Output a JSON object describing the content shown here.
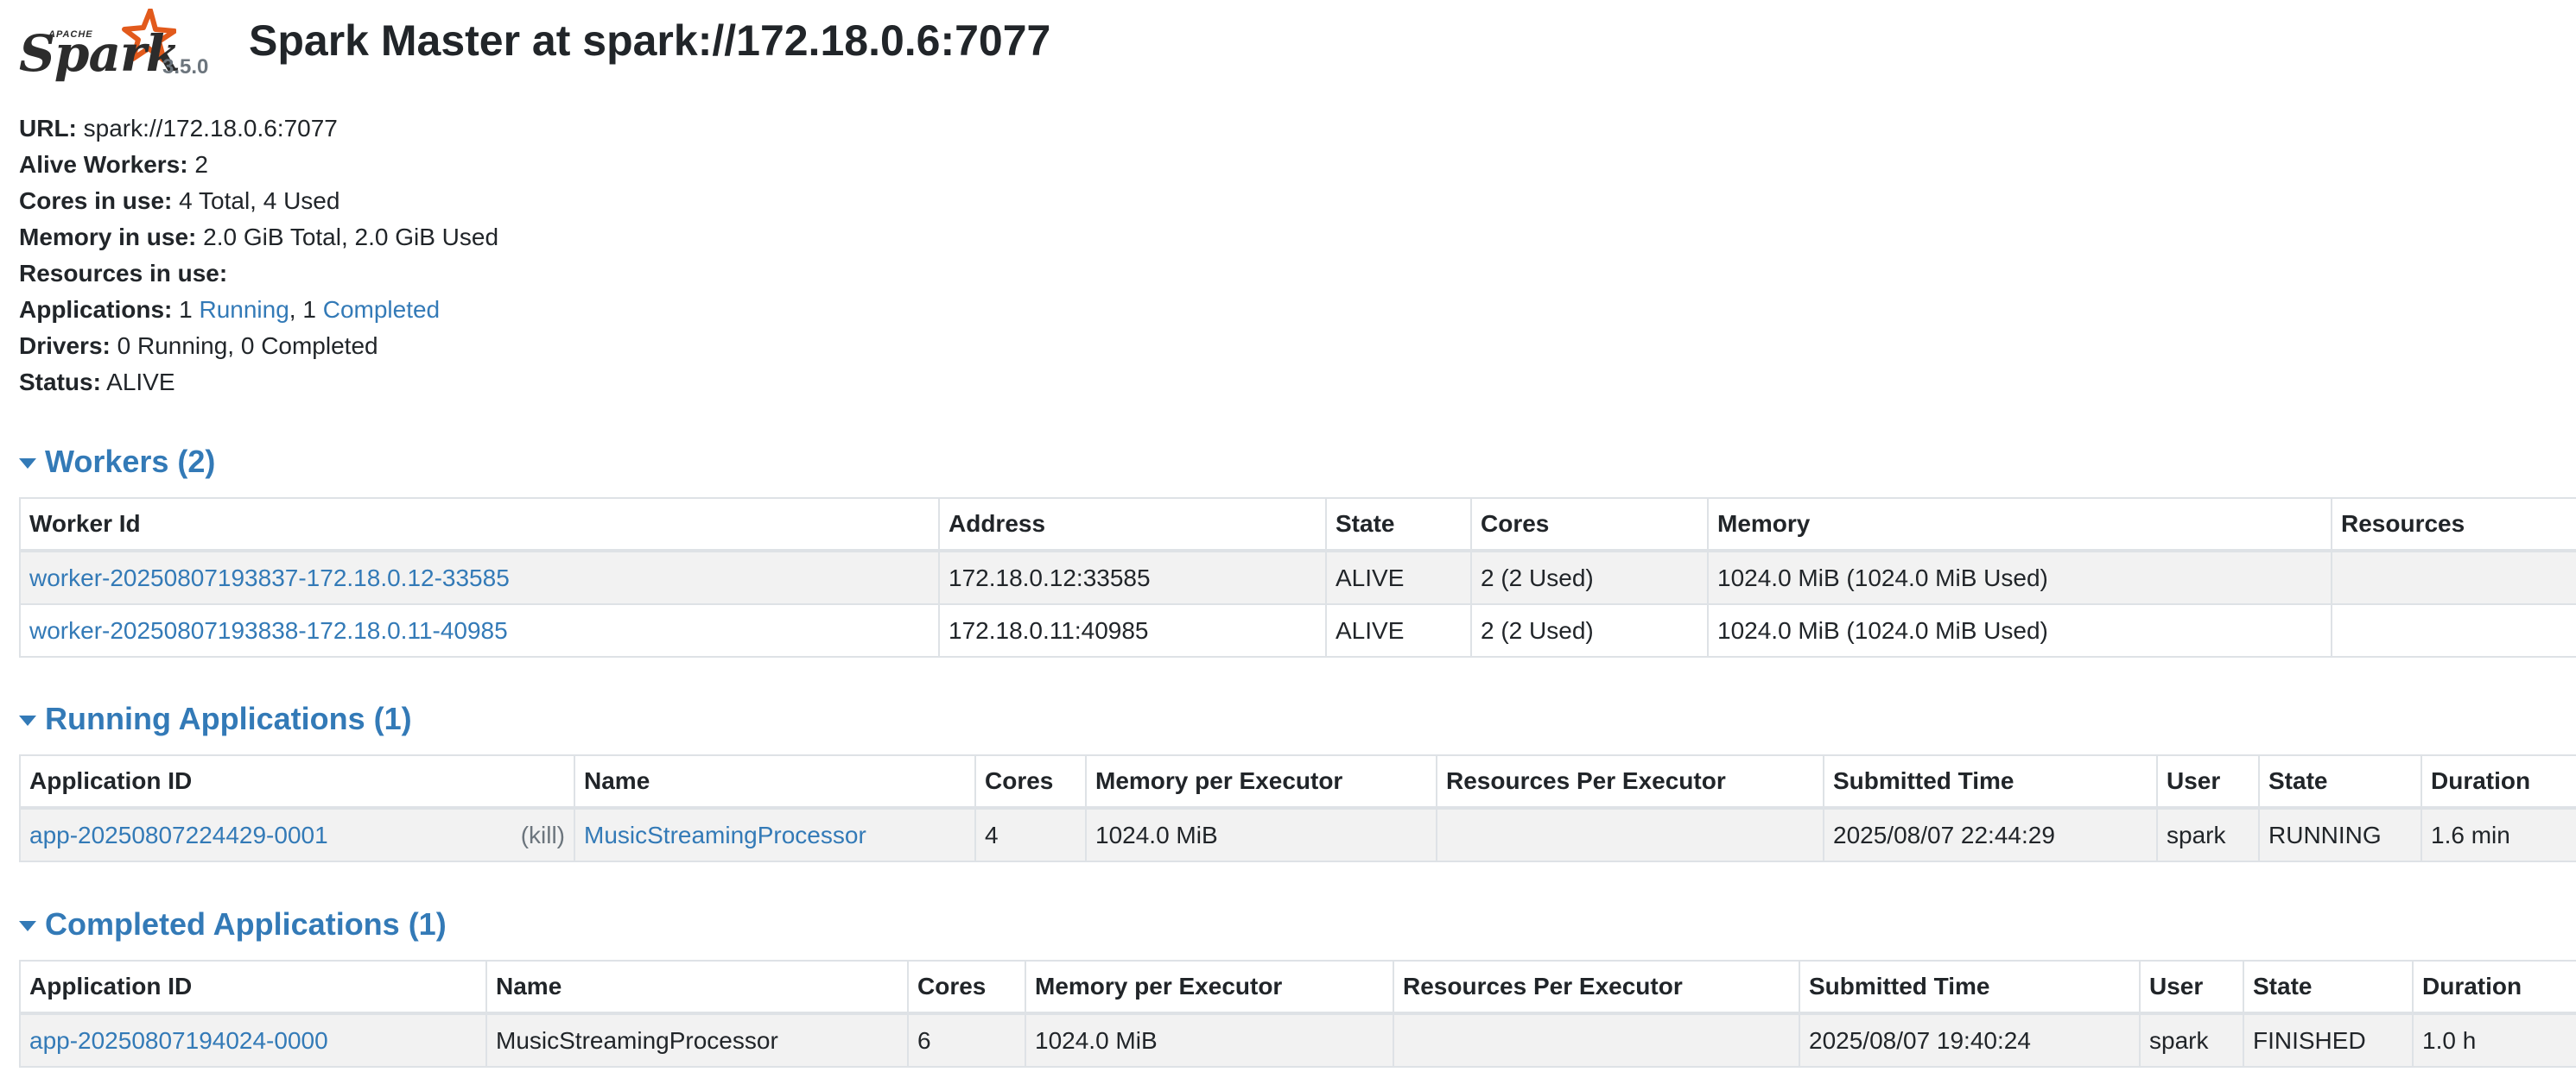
{
  "header": {
    "logo_apache": "APACHE",
    "logo_word": "Spark",
    "version": "3.5.0",
    "title": "Spark Master at spark://172.18.0.6:7077"
  },
  "summary": {
    "url_label": "URL:",
    "url_value": "spark://172.18.0.6:7077",
    "alive_workers_label": "Alive Workers:",
    "alive_workers_value": "2",
    "cores_label": "Cores in use:",
    "cores_value": "4 Total, 4 Used",
    "memory_label": "Memory in use:",
    "memory_value": "2.0 GiB Total, 2.0 GiB Used",
    "resources_label": "Resources in use:",
    "applications_label": "Applications:",
    "applications_running_count": "1",
    "applications_running_link": "Running",
    "applications_sep": ",",
    "applications_completed_count": "1",
    "applications_completed_link": "Completed",
    "drivers_label": "Drivers:",
    "drivers_value": "0 Running, 0 Completed",
    "status_label": "Status:",
    "status_value": "ALIVE"
  },
  "workers": {
    "title": "Workers (2)",
    "columns": [
      "Worker Id",
      "Address",
      "State",
      "Cores",
      "Memory",
      "Resources"
    ],
    "rows": [
      [
        "worker-20250807193837-172.18.0.12-33585",
        "172.18.0.12:33585",
        "ALIVE",
        "2 (2 Used)",
        "1024.0 MiB (1024.0 MiB Used)",
        ""
      ],
      [
        "worker-20250807193838-172.18.0.11-40985",
        "172.18.0.11:40985",
        "ALIVE",
        "2 (2 Used)",
        "1024.0 MiB (1024.0 MiB Used)",
        ""
      ]
    ]
  },
  "running": {
    "title": "Running Applications (1)",
    "columns": [
      "Application ID",
      "Name",
      "Cores",
      "Memory per Executor",
      "Resources Per Executor",
      "Submitted Time",
      "User",
      "State",
      "Duration"
    ],
    "kill_label": "(kill)",
    "rows": [
      [
        "app-20250807224429-0001",
        "MusicStreamingProcessor",
        "4",
        "1024.0 MiB",
        "",
        "2025/08/07 22:44:29",
        "spark",
        "RUNNING",
        "1.6 min"
      ]
    ]
  },
  "completed": {
    "title": "Completed Applications (1)",
    "columns": [
      "Application ID",
      "Name",
      "Cores",
      "Memory per Executor",
      "Resources Per Executor",
      "Submitted Time",
      "User",
      "State",
      "Duration"
    ],
    "rows": [
      [
        "app-20250807194024-0000",
        "MusicStreamingProcessor",
        "6",
        "1024.0 MiB",
        "",
        "2025/08/07 19:40:24",
        "spark",
        "FINISHED",
        "1.0 h"
      ]
    ]
  },
  "colors": {
    "link": "#337ab7",
    "logo_star": "#e25a1c",
    "row_stripe": "#f2f2f2"
  }
}
